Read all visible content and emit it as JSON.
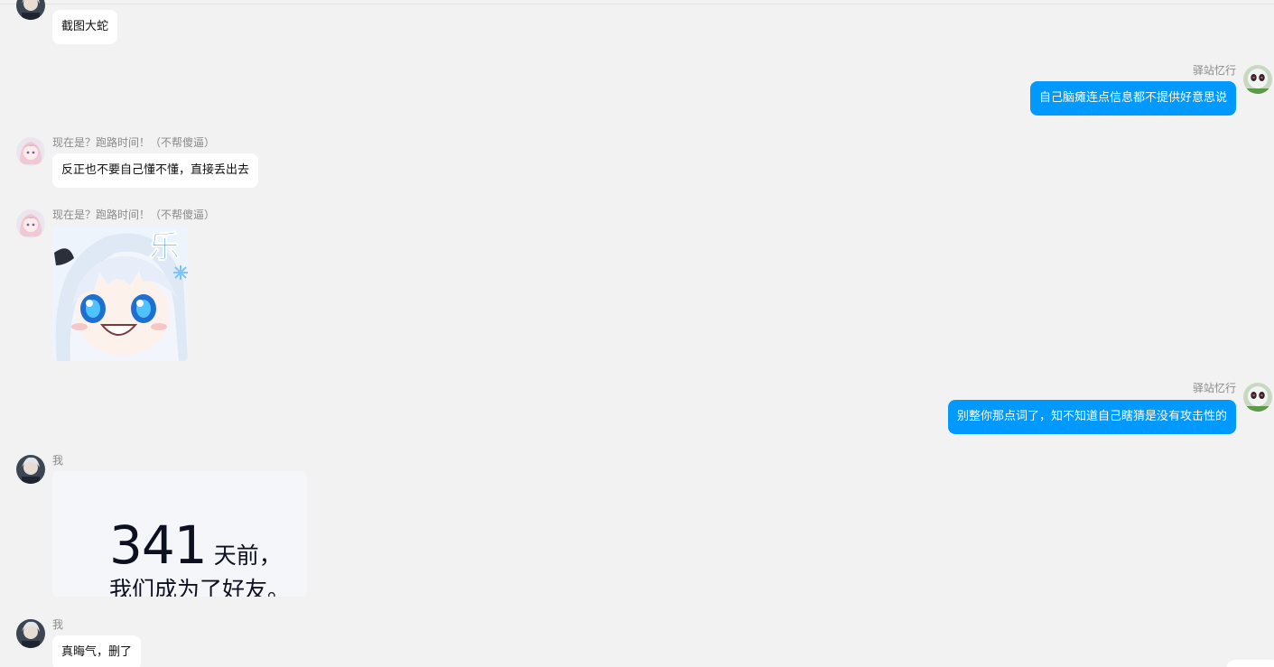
{
  "messages": [
    {
      "direction": "in",
      "sender": "",
      "text": "截图大蛇"
    },
    {
      "direction": "out",
      "sender": "驿站忆行",
      "text": "自己脑瘫连点信息都不提供好意思说"
    },
    {
      "direction": "in",
      "sender": "现在是？跑路时间！（不帮傻逼）",
      "text": "反正也不要自己懂不懂，直接丢出去"
    },
    {
      "direction": "in",
      "sender": "现在是？跑路时间！（不帮傻逼）",
      "sticker_text": "乐"
    },
    {
      "direction": "out",
      "sender": "驿站忆行",
      "text": "别整你那点词了，知不知道自己瞎猜是没有攻击性的"
    },
    {
      "direction": "in",
      "sender": "我",
      "image": {
        "number": "341",
        "unit": "天前，",
        "line2": "我们成为了好友。"
      }
    },
    {
      "direction": "in",
      "sender": "我",
      "text": "真晦气，删了"
    }
  ],
  "colors": {
    "background": "#f2f2f2",
    "incoming_bubble": "#ffffff",
    "outgoing_bubble": "#0099ff",
    "sender_name": "#8a8a8a"
  },
  "icons": {
    "me_avatar": "dark-haired-character-avatar-icon",
    "peer_avatar": "panda-character-avatar-icon",
    "group_member_avatar": "pink-anime-girl-avatar-icon"
  }
}
